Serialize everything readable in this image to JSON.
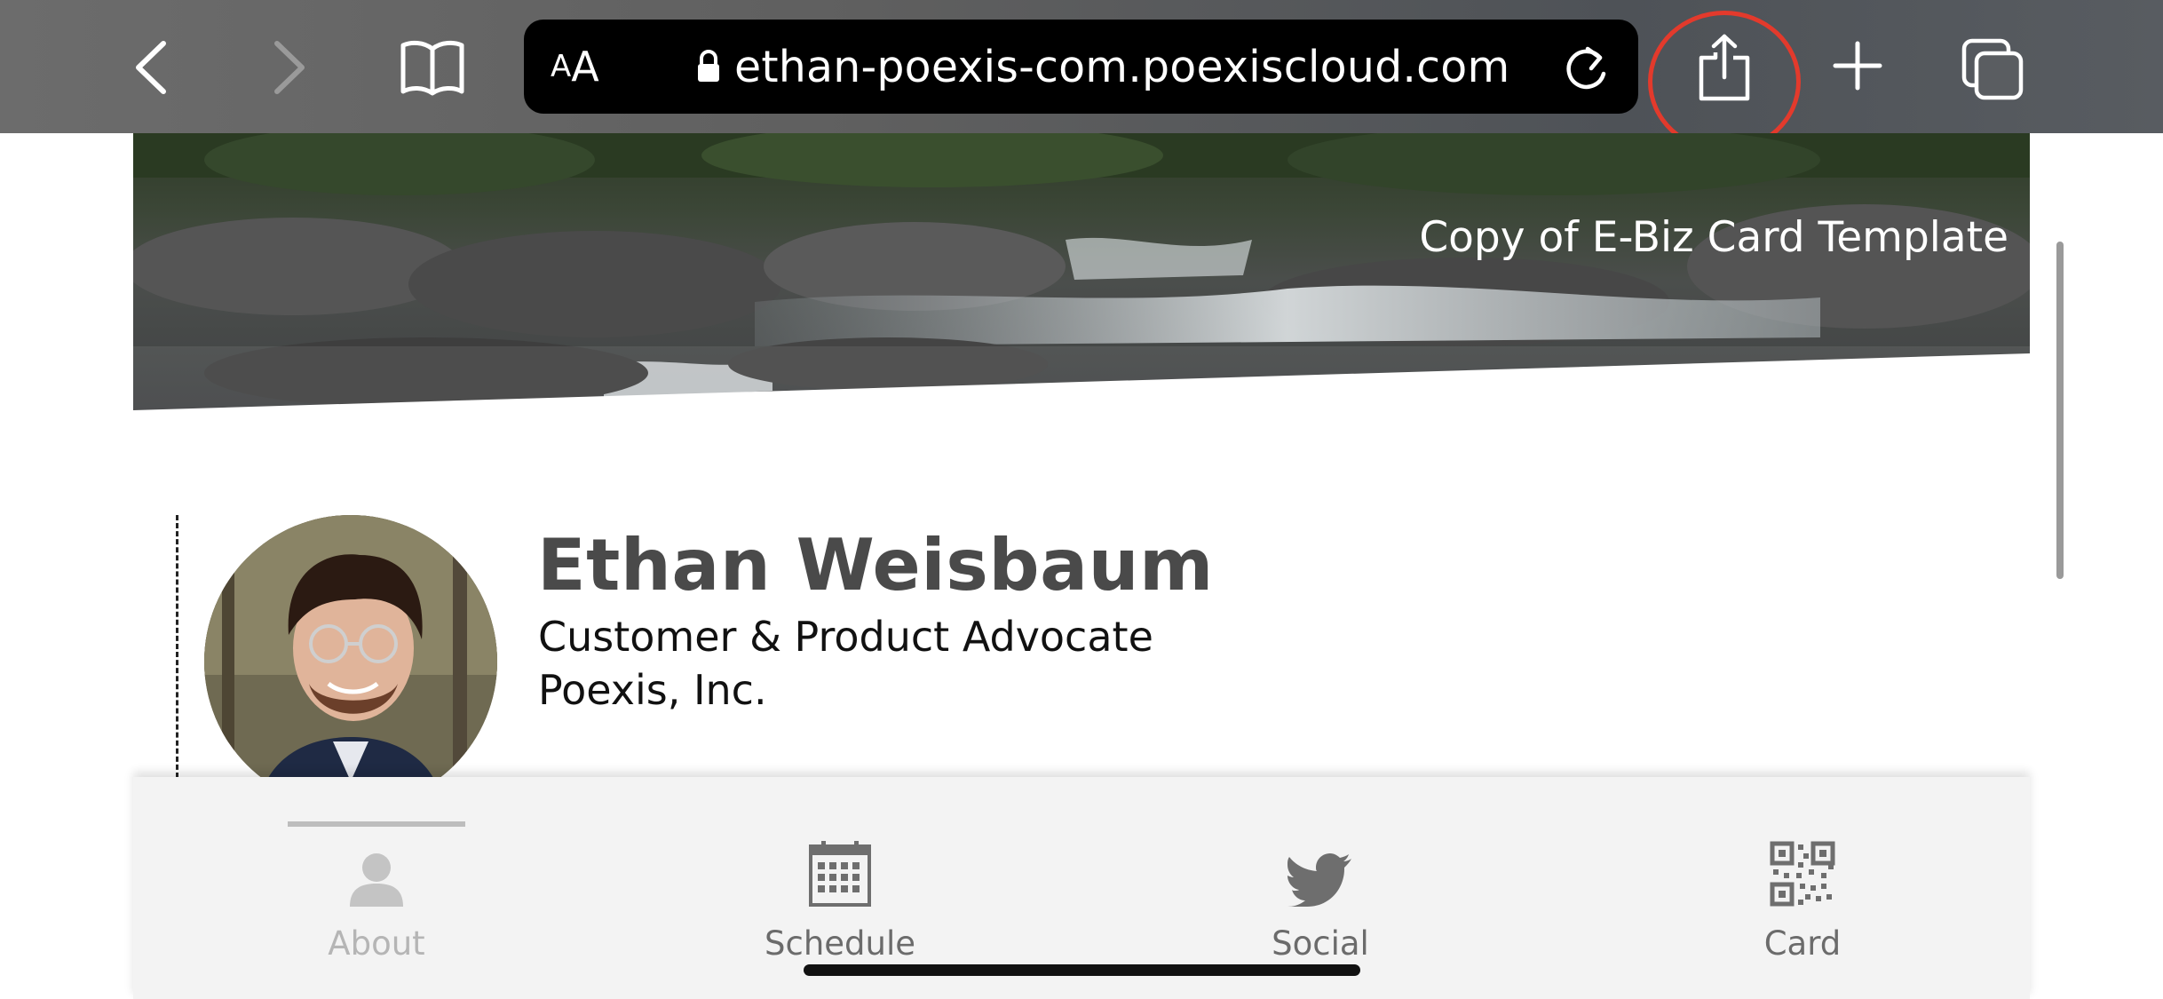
{
  "browser": {
    "text_size_button": {
      "small": "A",
      "large": "A"
    },
    "url": "ethan-poexis-com.poexiscloud.com",
    "share_highlight_color": "#e33a2c",
    "icons": [
      "back-icon",
      "forward-icon",
      "bookmarks-icon",
      "lock-icon",
      "reload-icon",
      "share-icon",
      "new-tab-icon",
      "tabs-icon"
    ]
  },
  "hero": {
    "label": "Copy of E-Biz Card Template"
  },
  "profile": {
    "name": "Ethan Weisbaum",
    "title": "Customer & Product Advocate",
    "company": "Poexis, Inc."
  },
  "bottom_nav": {
    "items": [
      {
        "label": "About",
        "icon": "person-icon",
        "active": true
      },
      {
        "label": "Schedule",
        "icon": "calendar-icon",
        "active": false
      },
      {
        "label": "Social",
        "icon": "twitter-bird-icon",
        "active": false
      },
      {
        "label": "Card",
        "icon": "qr-code-icon",
        "active": false
      }
    ]
  }
}
